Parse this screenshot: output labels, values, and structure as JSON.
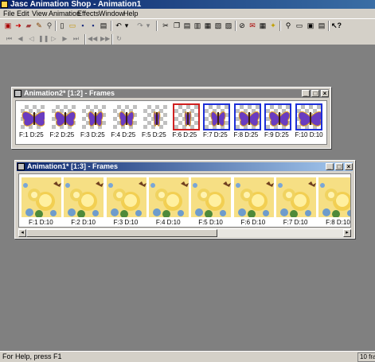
{
  "app": {
    "title": "Jasc Animation Shop - Animation1"
  },
  "menu": [
    "File",
    "Edit",
    "View",
    "Animation",
    "Effects",
    "Window",
    "Help"
  ],
  "toolbar": {
    "icons": [
      "crop-icon",
      "arrow-icon",
      "eraser-icon",
      "paintbrush-icon",
      "eyedropper-icon",
      "new-icon",
      "open-icon",
      "save-icon",
      "save-as-icon",
      "print-icon",
      "undo-icon",
      "undo-dropdown-icon",
      "redo-icon",
      "redo-dropdown-icon",
      "cut-icon",
      "copy-icon",
      "paste-icon",
      "paste-before-icon",
      "paste-after-icon",
      "paste-into-icon",
      "delete-icon",
      "insert-frame-icon",
      "view-animation-icon",
      "help-icon",
      "zoom-icon",
      "frame-properties-icon",
      "animation-properties-icon",
      "image-effects-icon",
      "context-help-icon"
    ]
  },
  "playback": {
    "icons": [
      "first-frame-icon",
      "previous-frame-icon",
      "play-back-icon",
      "pause-icon",
      "play-icon",
      "next-frame-icon",
      "last-frame-icon",
      "step-back-icon",
      "step-forward-icon",
      "loop-icon"
    ]
  },
  "windows": [
    {
      "title": "Animation2* [1:2] - Frames",
      "active": false,
      "frames": [
        {
          "label": "F:1  D:25",
          "kind": "butterfly-full"
        },
        {
          "label": "F:2  D:25",
          "kind": "butterfly-wide"
        },
        {
          "label": "F:3  D:25",
          "kind": "butterfly-mid"
        },
        {
          "label": "F:4  D:25",
          "kind": "butterfly-mid"
        },
        {
          "label": "F:5  D:25",
          "kind": "butterfly-thin"
        },
        {
          "label": "F:6  D:25",
          "kind": "butterfly-thin"
        },
        {
          "label": "F:7  D:25",
          "kind": "butterfly-mid"
        },
        {
          "label": "F:8  D:25",
          "kind": "butterfly-wide"
        },
        {
          "label": "F:9  D:25",
          "kind": "butterfly-wide"
        },
        {
          "label": "F:10  D:10",
          "kind": "butterfly-full"
        }
      ],
      "selection": {
        "current_frame": 6,
        "selected_frames": [
          6,
          7,
          8,
          9,
          10
        ]
      }
    },
    {
      "title": "Animation1* [1:3] - Frames",
      "active": true,
      "frames": [
        {
          "label": "F:1   D:10"
        },
        {
          "label": "F:2   D:10"
        },
        {
          "label": "F:3   D:10"
        },
        {
          "label": "F:4   D:10"
        },
        {
          "label": "F:5   D:10"
        },
        {
          "label": "F:6   D:10"
        },
        {
          "label": "F:7   D:10"
        },
        {
          "label": "F:8   D:10"
        }
      ]
    }
  ],
  "status": {
    "help": "For Help, press F1",
    "frames": "10 fra"
  }
}
